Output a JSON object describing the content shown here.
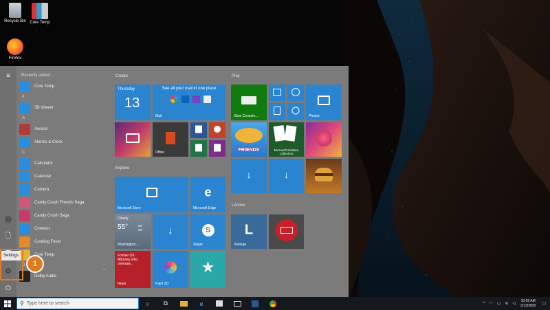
{
  "desktop": {
    "icons": [
      {
        "label": "Recycle Bin"
      },
      {
        "label": "Core Temp"
      },
      {
        "label": "Firefox"
      }
    ]
  },
  "start_menu": {
    "list_header": "Recently added",
    "apps": {
      "recent": [
        {
          "label": "Core Temp"
        }
      ],
      "hash_letter": "#",
      "hash": [
        {
          "label": "3D Viewer"
        }
      ],
      "a_letter": "A",
      "a": [
        {
          "label": "Access"
        },
        {
          "label": "Alarms & Clock"
        }
      ],
      "c_letter": "C",
      "c": [
        {
          "label": "Calculator"
        },
        {
          "label": "Calendar"
        },
        {
          "label": "Camera"
        },
        {
          "label": "Candy Crush Friends Saga"
        },
        {
          "label": "Candy Crush Saga"
        },
        {
          "label": "Connect"
        },
        {
          "label": "Cooking Fever"
        },
        {
          "label": "Core Temp"
        }
      ],
      "d_letter": "D",
      "d": [
        {
          "label": "Dolby Audio"
        }
      ]
    },
    "groups": {
      "create": "Create",
      "play": "Play",
      "explore": "Explore",
      "lenovo": "Lenovo"
    },
    "tiles": {
      "calendar_day": "Thursday",
      "calendar_date": "13",
      "mail_text": "See all your mail in one place",
      "mail_label": "Mail",
      "office_label": "Office",
      "xbox_label": "Xbox Console...",
      "photos_label": "Photos",
      "solitaire_label": "Microsoft Solitaire Collection",
      "friends_label": "FRIENDS",
      "store_label": "Microsoft Store",
      "edge_label": "Microsoft Edge",
      "weather_cond": "Cloudy",
      "weather_temp": "55°",
      "weather_hi": "55°",
      "weather_lo": "50°",
      "weather_city": "Washington,...",
      "skype_label": "Skype",
      "news_text": "Former US Attorney who oversaw...",
      "news_label": "News",
      "paint3d_label": "Paint 3D",
      "vantage_label": "Vantage"
    },
    "settings_label": "Settings",
    "step_number": "1"
  },
  "taskbar": {
    "search_placeholder": "Type here to search",
    "time": "10:02 AM",
    "date": "2/13/2020"
  }
}
